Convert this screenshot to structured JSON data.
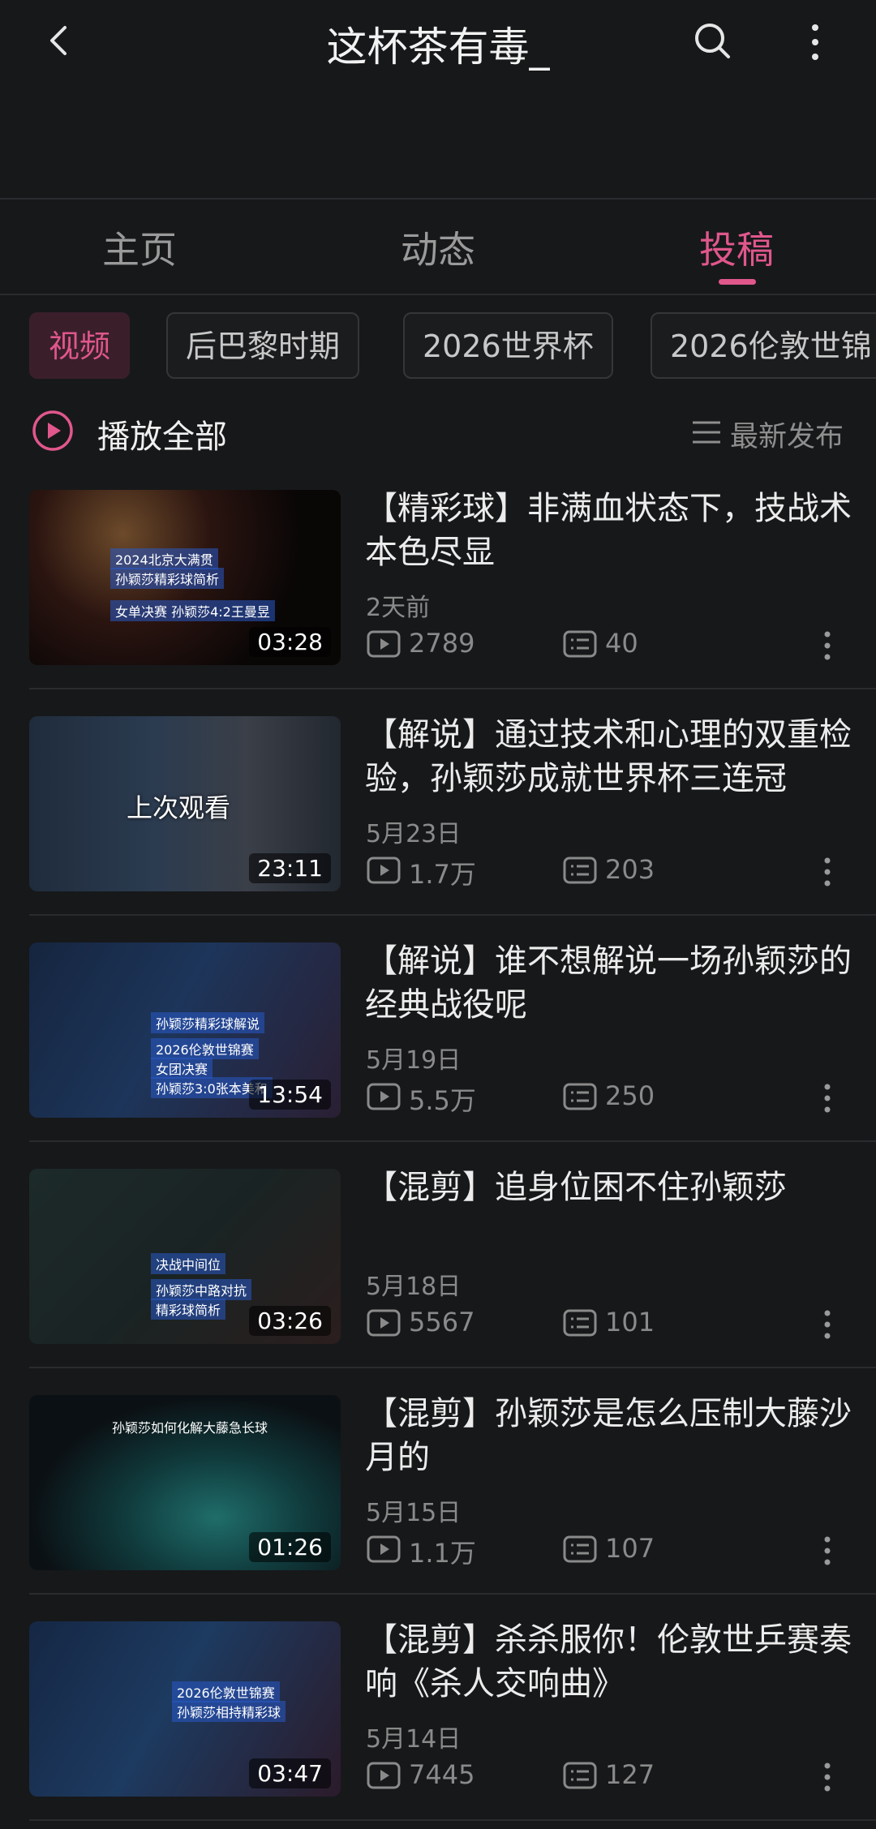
{
  "header": {
    "title": "这杯茶有毒_"
  },
  "tabs": [
    {
      "label": "主页",
      "active": false
    },
    {
      "label": "动态",
      "active": false
    },
    {
      "label": "投稿",
      "active": true
    }
  ],
  "filter_chips": [
    {
      "label": "视频",
      "active": true
    },
    {
      "label": "后巴黎时期",
      "active": false
    },
    {
      "label": "2026世界杯",
      "active": false
    },
    {
      "label": "2026伦敦世锦",
      "active": false
    }
  ],
  "play_all": {
    "label": "播放全部",
    "sort_label": "最新发布"
  },
  "videos": [
    {
      "title": "【精彩球】非满血状态下，技战术本色尽显",
      "date": "2天前",
      "views": "2789",
      "comments": "40",
      "duration": "03:28",
      "thumb_texts": [
        "2024北京大满贯",
        "孙颖莎精彩球简析",
        "女单决赛 孙颖莎4:2王曼昱"
      ]
    },
    {
      "title": "【解说】通过技术和心理的双重检验，孙颖莎成就世界杯三连冠",
      "date": "5月23日",
      "views": "1.7万",
      "comments": "203",
      "duration": "23:11",
      "last_watched": "上次观看"
    },
    {
      "title": "【解说】谁不想解说一场孙颖莎的经典战役呢",
      "date": "5月19日",
      "views": "5.5万",
      "comments": "250",
      "duration": "13:54",
      "thumb_texts": [
        "孙颖莎精彩球解说",
        "2026伦敦世锦赛",
        "女团决赛",
        "孙颖莎3:0张本美和"
      ]
    },
    {
      "title": "【混剪】追身位困不住孙颖莎",
      "date": "5月18日",
      "views": "5567",
      "comments": "101",
      "duration": "03:26",
      "thumb_texts": [
        "决战中间位",
        "孙颖莎中路对抗",
        "精彩球简析"
      ]
    },
    {
      "title": "【混剪】孙颖莎是怎么压制大藤沙月的",
      "date": "5月15日",
      "views": "1.1万",
      "comments": "107",
      "duration": "01:26",
      "thumb_texts": [
        "孙颖莎如何化解大藤急长球"
      ]
    },
    {
      "title": "【混剪】杀杀服你！伦敦世乒赛奏响《杀人交响曲》",
      "date": "5月14日",
      "views": "7445",
      "comments": "127",
      "duration": "03:47",
      "thumb_texts": [
        "2026伦敦世锦赛",
        "孙颖莎相持精彩球"
      ]
    }
  ],
  "colors": {
    "accent": "#e0578c",
    "background": "#17181a",
    "muted": "#8a8a8a"
  }
}
